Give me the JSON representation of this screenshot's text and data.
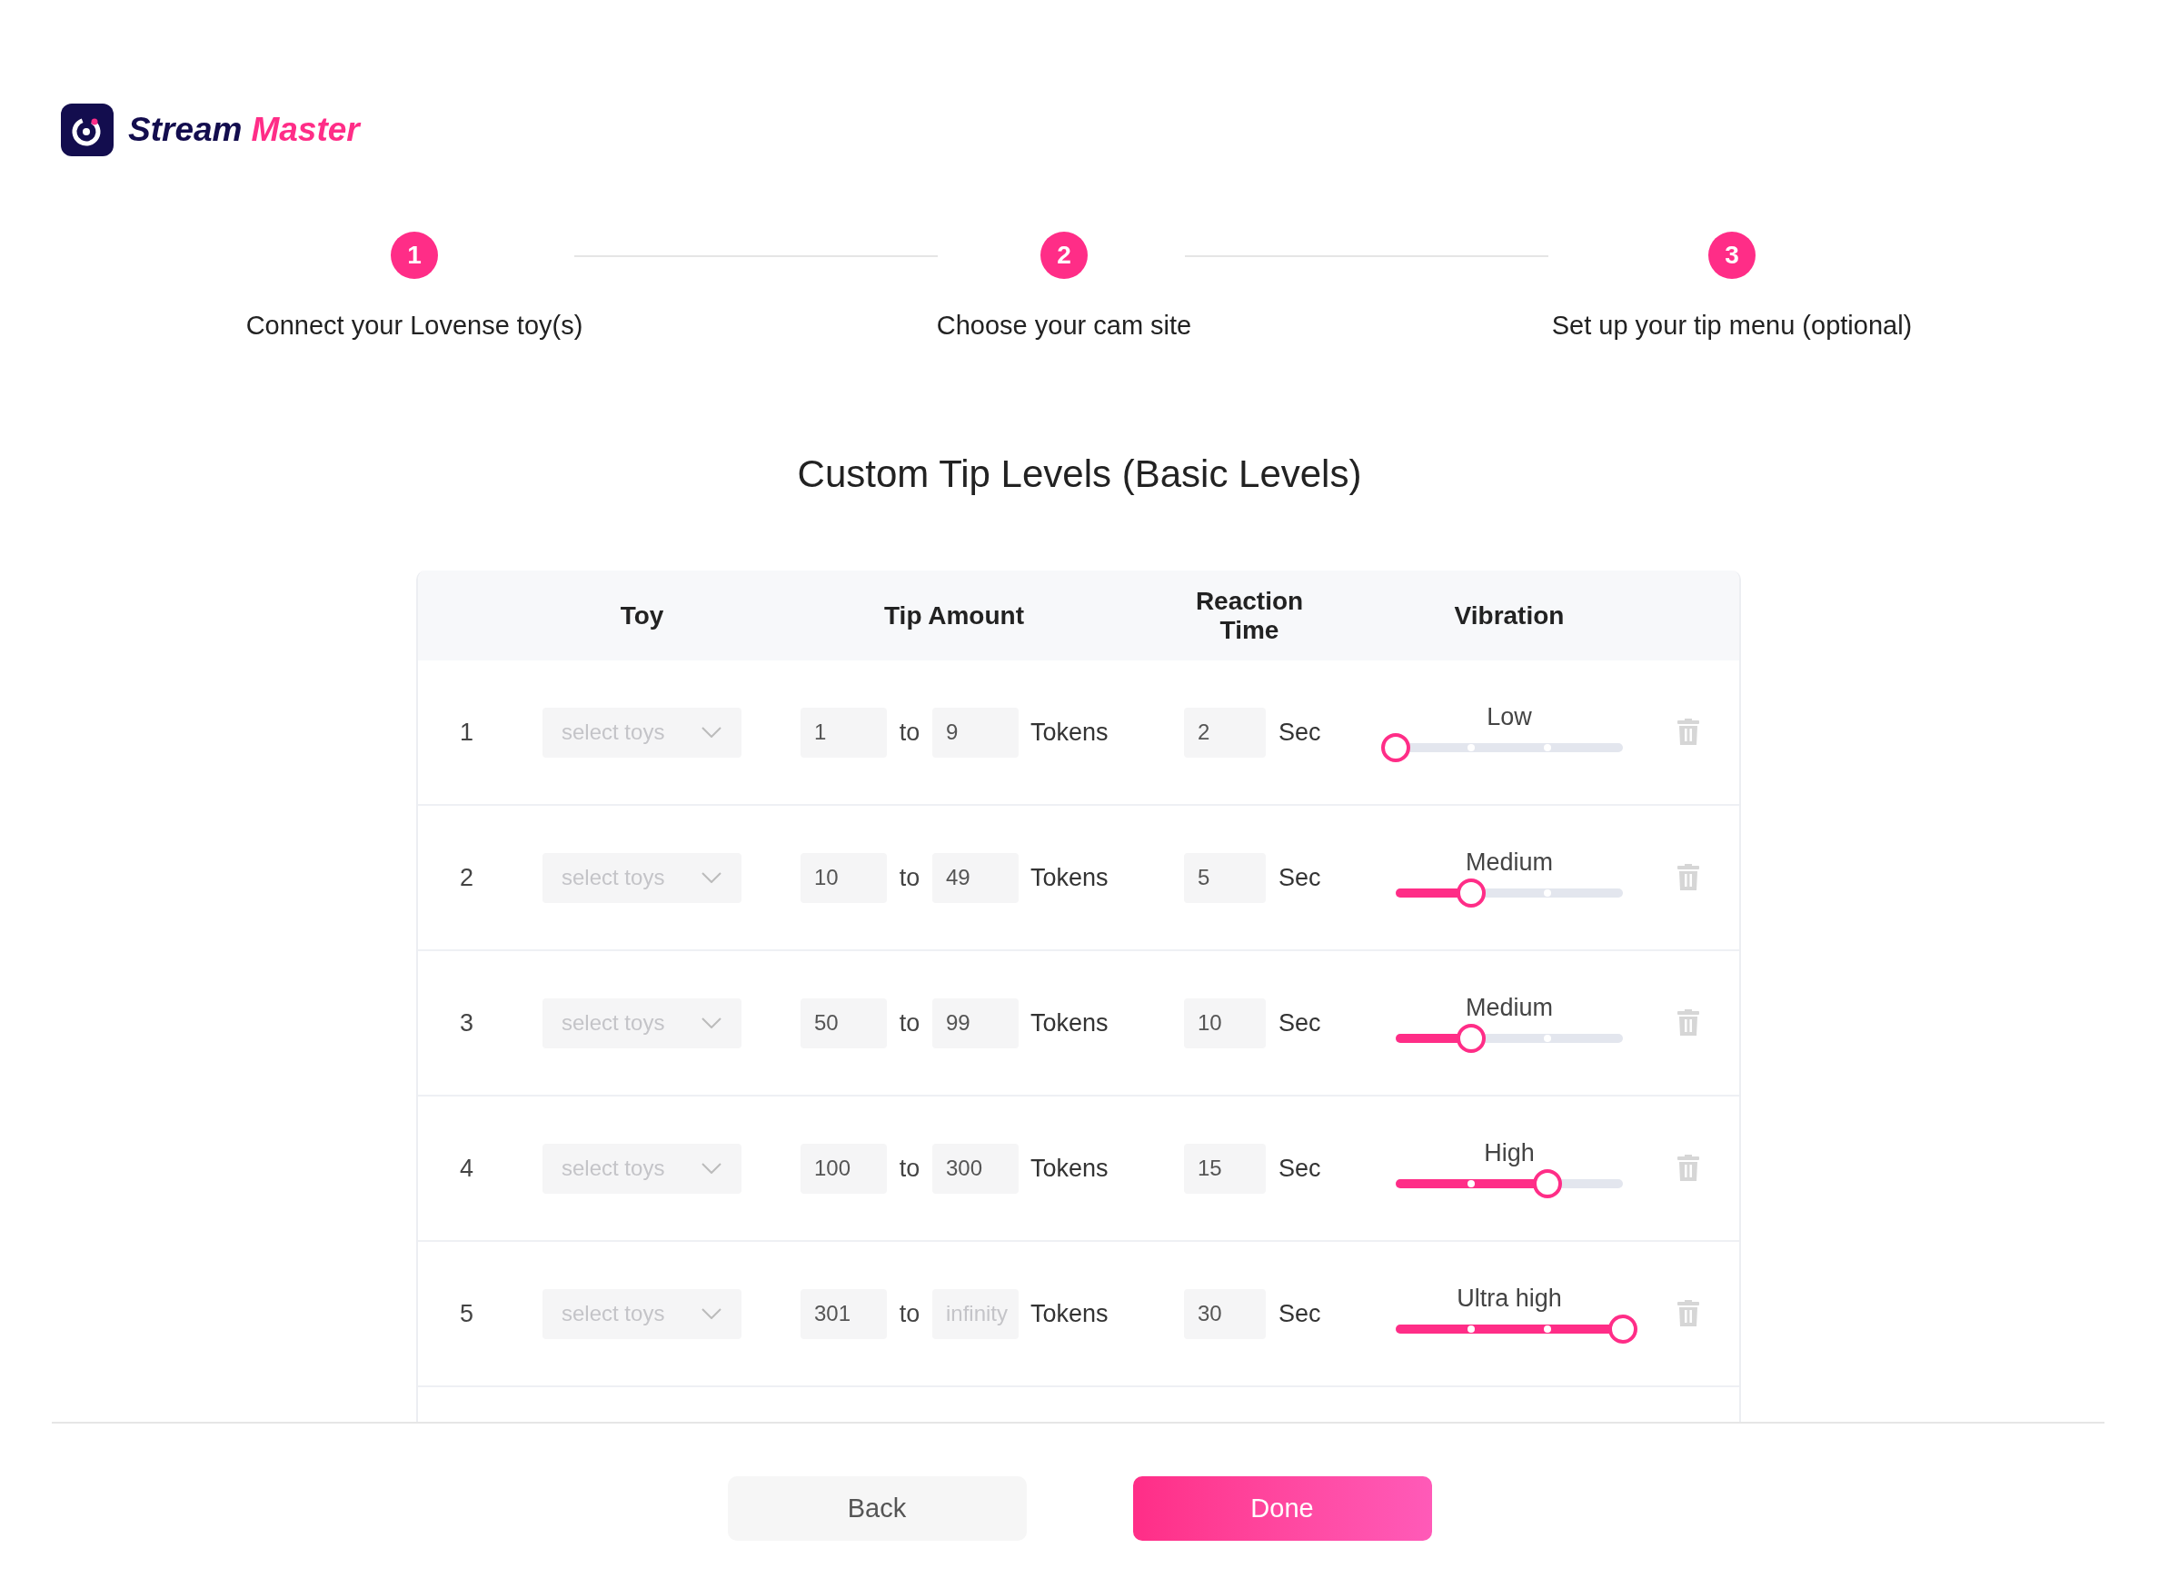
{
  "brand": {
    "name_part_1": "Stream",
    "name_part_2": "Master"
  },
  "steps": [
    {
      "number": "1",
      "label": "Connect your Lovense toy(s)"
    },
    {
      "number": "2",
      "label": "Choose your cam site"
    },
    {
      "number": "3",
      "label": "Set up your tip menu (optional)"
    }
  ],
  "title": "Custom Tip Levels (Basic Levels)",
  "table": {
    "columns": [
      "Toy",
      "Tip Amount",
      "Reaction Time",
      "Vibration"
    ],
    "rows": [
      {
        "index": "1",
        "toy_placeholder": "select toys",
        "tip_from": "1",
        "to": "to",
        "tip_to": {
          "value": "9"
        },
        "unit": "Tokens",
        "reaction": "2",
        "reaction_unit": "Sec",
        "vibration_label": "Low",
        "level": 0
      },
      {
        "index": "2",
        "toy_placeholder": "select toys",
        "tip_from": "10",
        "to": "to",
        "tip_to": {
          "value": "49"
        },
        "unit": "Tokens",
        "reaction": "5",
        "reaction_unit": "Sec",
        "vibration_label": "Medium",
        "level": 0.3333
      },
      {
        "index": "3",
        "toy_placeholder": "select toys",
        "tip_from": "50",
        "to": "to",
        "tip_to": {
          "value": "99"
        },
        "unit": "Tokens",
        "reaction": "10",
        "reaction_unit": "Sec",
        "vibration_label": "Medium",
        "level": 0.3333
      },
      {
        "index": "4",
        "toy_placeholder": "select toys",
        "tip_from": "100",
        "to": "to",
        "tip_to": {
          "value": "300"
        },
        "unit": "Tokens",
        "reaction": "15",
        "reaction_unit": "Sec",
        "vibration_label": "High",
        "level": 0.6667
      },
      {
        "index": "5",
        "toy_placeholder": "select toys",
        "tip_from": "301",
        "to": "to",
        "tip_to": {
          "placeholder": "infinity"
        },
        "unit": "Tokens",
        "reaction": "30",
        "reaction_unit": "Sec",
        "vibration_label": "Ultra high",
        "level": 1
      }
    ]
  },
  "buttons": [
    {
      "label": "Back",
      "kind": "secondary"
    },
    {
      "label": "Done",
      "kind": "primary"
    }
  ]
}
